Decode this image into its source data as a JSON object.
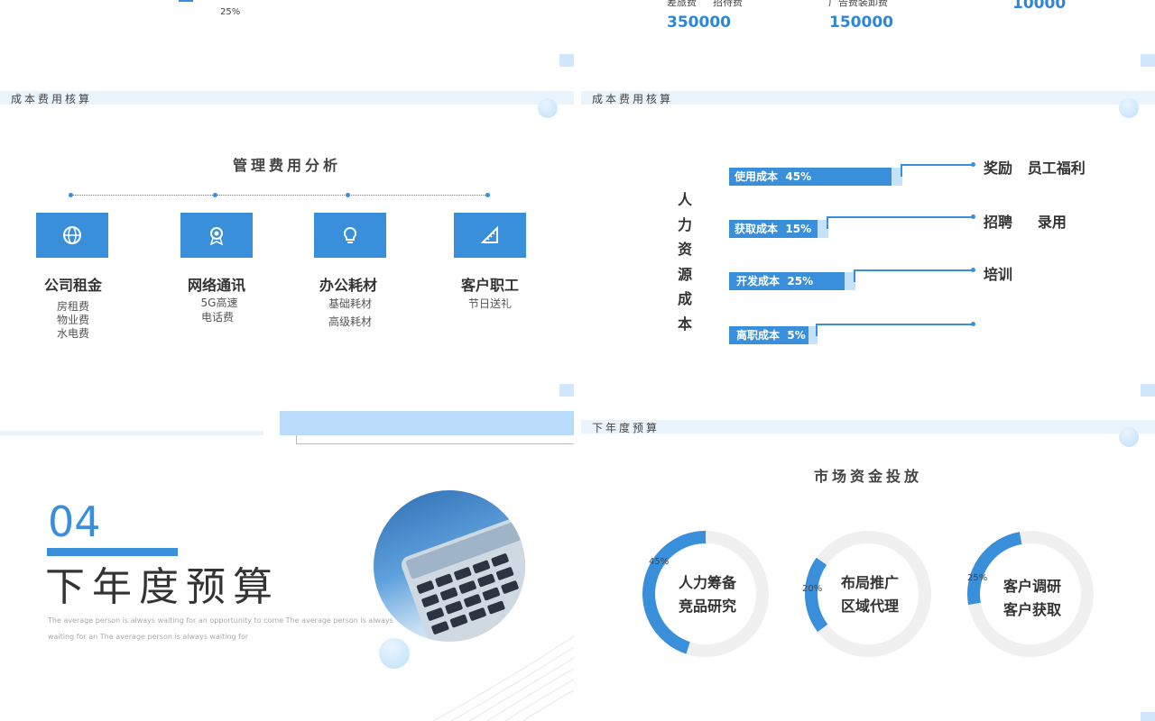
{
  "top_left": {
    "pct": "25%"
  },
  "top_right": {
    "labels": [
      "差旅费",
      "招待费",
      "广告费装卸费"
    ],
    "values": [
      "350000",
      "150000",
      "10000"
    ]
  },
  "slide_cost": {
    "header": "成本费用核算",
    "title": "管理费用分析",
    "items": [
      {
        "title": "公司租金",
        "lines": [
          "房租费",
          "物业费",
          "水电费"
        ],
        "icon": "globe-icon"
      },
      {
        "title": "网络通讯",
        "lines": [
          "5G高速",
          "电话费"
        ],
        "icon": "award-icon"
      },
      {
        "title": "办公耗材",
        "lines": [
          "基础耗材",
          "高级耗材"
        ],
        "icon": "lightbulb-icon"
      },
      {
        "title": "客户职工",
        "lines": [
          "节日送礼"
        ],
        "icon": "ruler-icon"
      }
    ]
  },
  "slide_hr": {
    "header": "成本费用核算",
    "vertical_title": [
      "人",
      "力",
      "资",
      "源",
      "成",
      "本"
    ],
    "bars": [
      {
        "label": "使用成本",
        "pct": "45%",
        "value": 45
      },
      {
        "label": "获取成本",
        "pct": "15%",
        "value": 15
      },
      {
        "label": "开发成本",
        "pct": "25%",
        "value": 25
      },
      {
        "label": "离职成本",
        "pct": "5%",
        "value": 5
      }
    ],
    "right_labels": [
      "奖励   员工福利",
      "招聘     录用",
      "培训"
    ]
  },
  "slide_section": {
    "number": "04",
    "title": "下年度预算",
    "desc_line1": "The average person is always waiting for an opportunity to come The average person is always",
    "desc_line2": "waiting for an The average person is always waiting for"
  },
  "slide_market": {
    "header": "下年度预算",
    "title": "市场资金投放",
    "donuts": [
      {
        "pct_label": "45%",
        "value": 45,
        "line1": "人力筹备",
        "line2": "竞品研究"
      },
      {
        "pct_label": "20%",
        "value": 20,
        "line1": "布局推广",
        "line2": "区域代理"
      },
      {
        "pct_label": "25%",
        "value": 25,
        "line1": "客户调研",
        "line2": "客户获取"
      }
    ]
  },
  "colors": {
    "accent": "#3a8fdb",
    "light": "#eaf4fd",
    "track": "#f0f0f0"
  }
}
